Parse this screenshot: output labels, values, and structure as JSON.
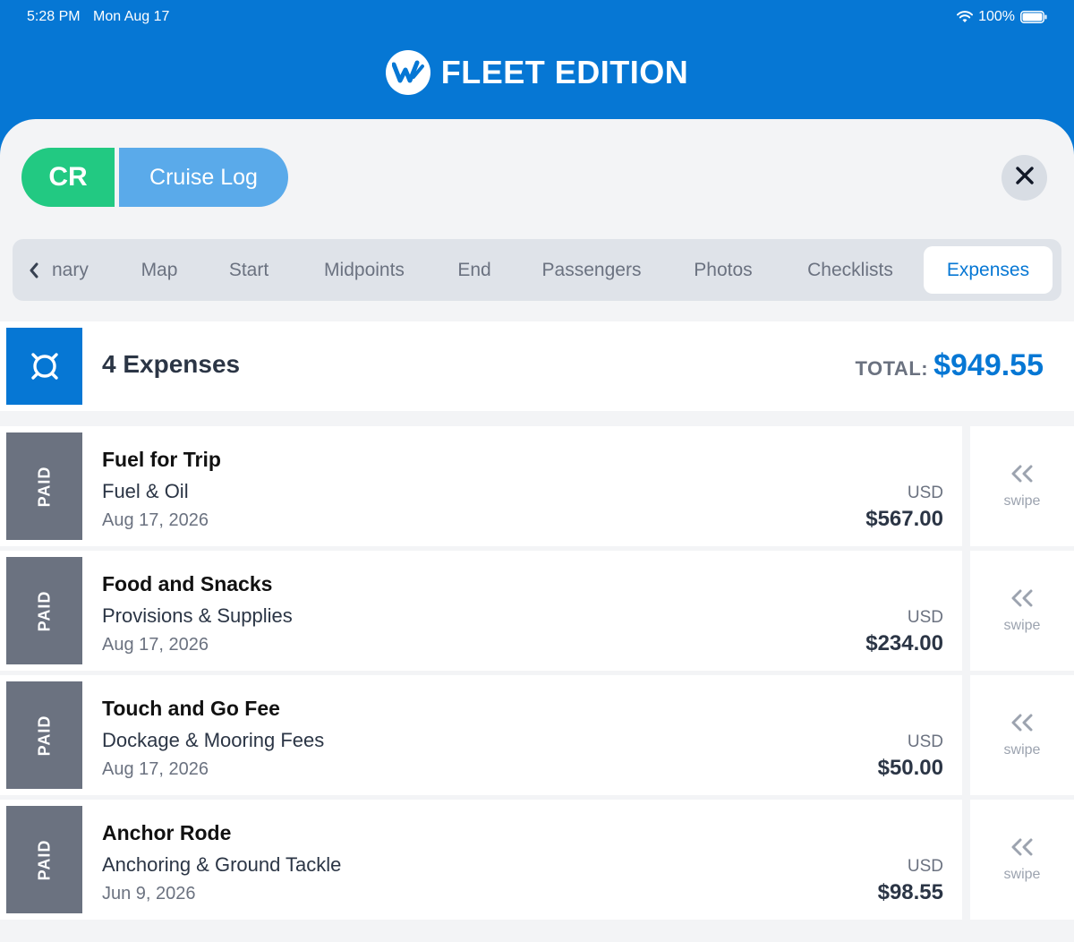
{
  "status_bar": {
    "time": "5:28 PM",
    "date": "Mon Aug 17",
    "battery": "100%"
  },
  "header": {
    "brand": "FLEET EDITION"
  },
  "log": {
    "code": "CR",
    "name": "Cruise Log"
  },
  "tabs": [
    {
      "label": "nary",
      "active": false
    },
    {
      "label": "Map",
      "active": false
    },
    {
      "label": "Start",
      "active": false
    },
    {
      "label": "Midpoints",
      "active": false
    },
    {
      "label": "End",
      "active": false
    },
    {
      "label": "Passengers",
      "active": false
    },
    {
      "label": "Photos",
      "active": false
    },
    {
      "label": "Checklists",
      "active": false
    },
    {
      "label": "Expenses",
      "active": true
    }
  ],
  "summary": {
    "count_label": "4 Expenses",
    "total_label": "TOTAL:",
    "total_value": "$949.55"
  },
  "expenses": [
    {
      "status": "PAID",
      "title": "Fuel for Trip",
      "category": "Fuel & Oil",
      "date": "Aug 17, 2026",
      "currency": "USD",
      "amount": "$567.00",
      "swipe": "swipe"
    },
    {
      "status": "PAID",
      "title": "Food and Snacks",
      "category": "Provisions & Supplies",
      "date": "Aug 17, 2026",
      "currency": "USD",
      "amount": "$234.00",
      "swipe": "swipe"
    },
    {
      "status": "PAID",
      "title": "Touch and Go Fee",
      "category": "Dockage & Mooring Fees",
      "date": "Aug 17, 2026",
      "currency": "USD",
      "amount": "$50.00",
      "swipe": "swipe"
    },
    {
      "status": "PAID",
      "title": "Anchor Rode",
      "category": "Anchoring & Ground Tackle",
      "date": "Jun 9, 2026",
      "currency": "USD",
      "amount": "$98.55",
      "swipe": "swipe"
    }
  ],
  "colors": {
    "brand_blue": "#0677d4",
    "green": "#22c982",
    "light_blue": "#5aaaea",
    "paid_gray": "#6b7280"
  }
}
